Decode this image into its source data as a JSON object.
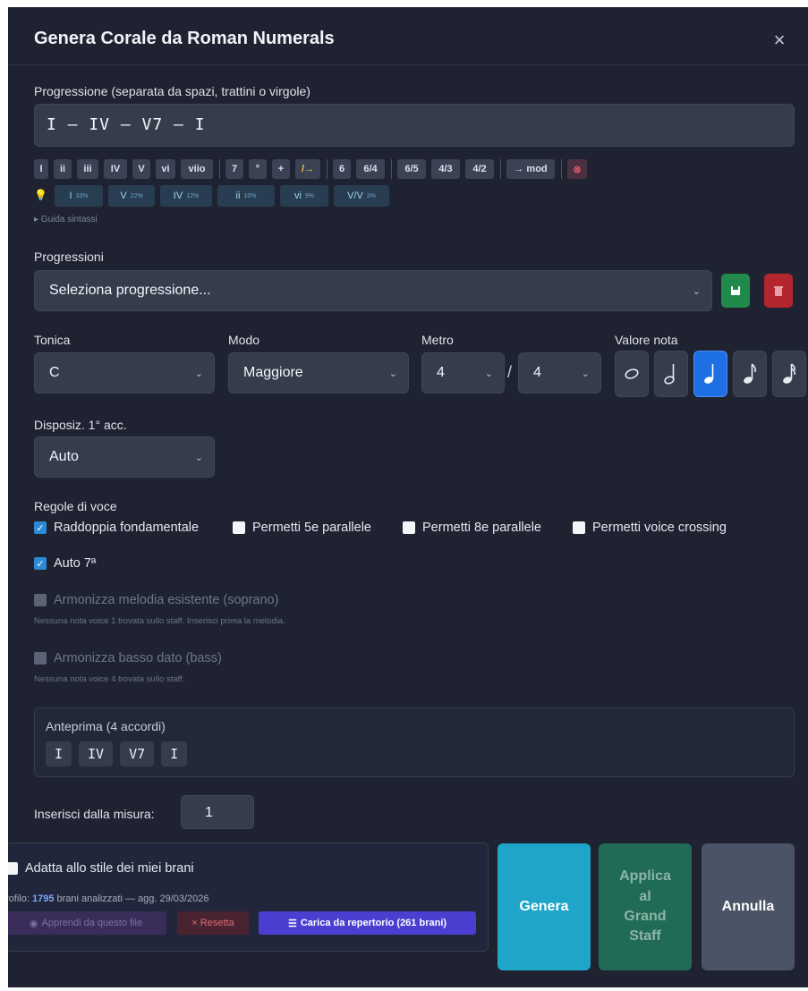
{
  "dialog": {
    "title": "Genera Corale da Roman Numerals",
    "close_label": "×"
  },
  "progression": {
    "label": "Progressione (separata da spazi, trattini o virgole)",
    "value": "I – IV – V7 – I",
    "symbols": [
      "I",
      "ii",
      "iii",
      "IV",
      "V",
      "vi",
      "viio",
      "7",
      "°",
      "+",
      "/→",
      "6",
      "6/4",
      "6/5",
      "4/3",
      "4/2",
      "→ mod",
      "⊗"
    ],
    "suggestions_icon": "lightbulb-icon",
    "suggestions": [
      {
        "label": "I",
        "pct": "33%"
      },
      {
        "label": "V",
        "pct": "22%"
      },
      {
        "label": "IV",
        "pct": "12%"
      },
      {
        "label": "ii",
        "pct": "10%"
      },
      {
        "label": "vi",
        "pct": "9%"
      },
      {
        "label": "V/V",
        "pct": "3%"
      }
    ],
    "guide_label": "▸ Guida sintassi"
  },
  "progressions": {
    "label": "Progressioni",
    "selected": "Seleziona progressione...",
    "save_icon": "save-icon",
    "delete_icon": "trash-icon"
  },
  "tonic": {
    "label": "Tonica",
    "value": "C"
  },
  "mode": {
    "label": "Modo",
    "value": "Maggiore"
  },
  "meter": {
    "label": "Metro",
    "numerator": "4",
    "separator": "/",
    "denominator": "4"
  },
  "note_value": {
    "label": "Valore nota",
    "options": [
      "whole-note-icon",
      "half-note-icon",
      "quarter-note-icon",
      "eighth-note-icon",
      "sixteenth-note-icon"
    ],
    "selected": "quarter-note-icon"
  },
  "first_chord": {
    "label": "Disposiz. 1° acc.",
    "value": "Auto"
  },
  "voice_rules": {
    "label": "Regole di voce",
    "items": [
      {
        "label": "Raddoppia fondamentale",
        "checked": true
      },
      {
        "label": "Permetti 5e parallele",
        "checked": false
      },
      {
        "label": "Permetti 8e parallele",
        "checked": false
      },
      {
        "label": "Permetti voice crossing",
        "checked": false
      }
    ],
    "auto7": {
      "label": "Auto 7ª",
      "checked": true
    }
  },
  "harmonize_melody": {
    "label": "Armonizza melodia esistente (soprano)",
    "hint": "Nessuna nota voice 1 trovata sullo staff. Inserisci prima la melodia."
  },
  "harmonize_bass": {
    "label": "Armonizza basso dato (bass)",
    "hint": "Nessuna nota voice 4 trovata sullo staff."
  },
  "preview": {
    "label": "Anteprima (4 accordi)",
    "chords": [
      "I",
      "IV",
      "V7",
      "I"
    ]
  },
  "insert_from": {
    "label": "Inserisci dalla misura:",
    "value": "1"
  },
  "style": {
    "label": "Adatta allo stile dei miei brani",
    "profile_prefix": "rofilo:",
    "profile_count": "1795",
    "profile_suffix": "brani analizzati — agg. 29/03/2026",
    "learn_label": "Apprendi da questo file",
    "reset_label": "× Resetta",
    "load_label": "Carica da repertorio (261 brani)"
  },
  "actions": {
    "generate": "Genera",
    "apply_line1": "Applica",
    "apply_line2": "al",
    "apply_line3": "Grand",
    "apply_line4": "Staff",
    "cancel": "Annulla"
  },
  "colors": {
    "background": "#1f2331",
    "accent_blue": "#1e6fe3",
    "generate": "#1ea5c9",
    "apply": "#1f6b57",
    "cancel": "#4b5366",
    "save": "#1f8a4c",
    "delete": "#b3262e"
  }
}
